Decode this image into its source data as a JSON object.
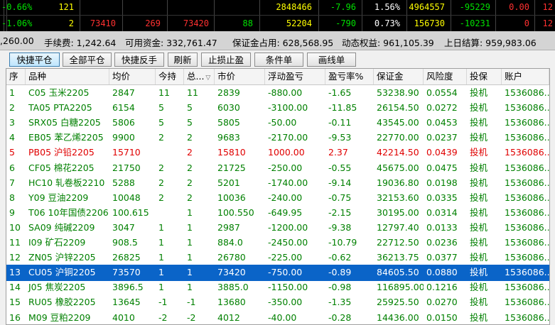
{
  "quotes": [
    [
      "-0.66%",
      "121",
      "",
      "",
      "",
      "",
      "2848466",
      "-7.96",
      "1.56%",
      "4964557",
      "-95229",
      "0.00",
      "12"
    ],
    [
      "-1.06%",
      "2",
      "73410",
      "269",
      "73420",
      "88",
      "52204",
      "-790",
      "0.73%",
      "156730",
      "-10231",
      "0",
      "12"
    ]
  ],
  "account": {
    "left": ",260.00",
    "fee_label": "手续费: 1,242.64",
    "available": "可用资金: 332,761.47",
    "margin": "保证金占用: 628,568.95",
    "equity": "动态权益: 961,105.39",
    "settle": "上日结算: 959,983.06"
  },
  "toolbar": [
    "快捷平仓",
    "全部平仓",
    "快捷反手",
    "刷新",
    "止损止盈",
    "条件单",
    "画线单"
  ],
  "columns": [
    "序",
    "品种",
    "均价",
    "今持",
    "总...",
    "市价",
    "浮动盈亏",
    "盈亏率%",
    "保证金",
    "风险度",
    "投保",
    "账户"
  ],
  "rows": [
    [
      "1",
      "C05 玉米2205",
      "2847",
      "11",
      "11",
      "2839",
      "-880.00",
      "-1.65",
      "53238.90",
      "0.0554",
      "投机",
      "1536086..."
    ],
    [
      "2",
      "TA05 PTA2205",
      "6154",
      "5",
      "5",
      "6030",
      "-3100.00",
      "-11.85",
      "26154.50",
      "0.0272",
      "投机",
      "1536086..."
    ],
    [
      "3",
      "SRX05 白糖2205",
      "5806",
      "5",
      "5",
      "5805",
      "-50.00",
      "-0.11",
      "43545.00",
      "0.0453",
      "投机",
      "1536086..."
    ],
    [
      "4",
      "EB05 苯乙烯2205",
      "9900",
      "2",
      "2",
      "9683",
      "-2170.00",
      "-9.53",
      "22770.00",
      "0.0237",
      "投机",
      "1536086..."
    ],
    [
      "5",
      "PB05 沪铅2205",
      "15710",
      "",
      "2",
      "15810",
      "1000.00",
      "2.37",
      "42214.50",
      "0.0439",
      "投机",
      "1536086..."
    ],
    [
      "6",
      "CF05 棉花2205",
      "21750",
      "2",
      "2",
      "21725",
      "-250.00",
      "-0.55",
      "45675.00",
      "0.0475",
      "投机",
      "1536086..."
    ],
    [
      "7",
      "HC10 轧卷板2210",
      "5288",
      "2",
      "2",
      "5201",
      "-1740.00",
      "-9.14",
      "19036.80",
      "0.0198",
      "投机",
      "1536086..."
    ],
    [
      "8",
      "Y09 豆油2209",
      "10048",
      "2",
      "2",
      "10036",
      "-240.00",
      "-0.75",
      "32153.60",
      "0.0335",
      "投机",
      "1536086..."
    ],
    [
      "9",
      "T06 10年国债2206",
      "100.615",
      "",
      "1",
      "100.550",
      "-649.95",
      "-2.15",
      "30195.00",
      "0.0314",
      "投机",
      "1536086..."
    ],
    [
      "10",
      "SA09 纯碱2209",
      "3047",
      "1",
      "1",
      "2987",
      "-1200.00",
      "-9.38",
      "12797.40",
      "0.0133",
      "投机",
      "1536086..."
    ],
    [
      "11",
      "I09 矿石2209",
      "908.5",
      "1",
      "1",
      "884.0",
      "-2450.00",
      "-10.79",
      "22712.50",
      "0.0236",
      "投机",
      "1536086..."
    ],
    [
      "12",
      "ZN05 沪锌2205",
      "26825",
      "1",
      "1",
      "26780",
      "-225.00",
      "-0.62",
      "36213.75",
      "0.0377",
      "投机",
      "1536086..."
    ],
    [
      "13",
      "CU05 沪铜2205",
      "73570",
      "1",
      "1",
      "73420",
      "-750.00",
      "-0.89",
      "84605.50",
      "0.0880",
      "投机",
      "1536086..."
    ],
    [
      "14",
      "J05 焦炭2205",
      "3896.5",
      "1",
      "1",
      "3885.0",
      "-1150.00",
      "-0.98",
      "116895.00",
      "0.1216",
      "投机",
      "1536086..."
    ],
    [
      "15",
      "RU05 橡胶2205",
      "13645",
      "-1",
      "-1",
      "13680",
      "-350.00",
      "-1.35",
      "25925.50",
      "0.0270",
      "投机",
      "1536086..."
    ],
    [
      "16",
      "M09 豆粕2209",
      "4010",
      "-2",
      "-2",
      "4012",
      "-40.00",
      "-0.28",
      "14436.00",
      "0.0150",
      "投机",
      "1536086..."
    ]
  ],
  "selected_row": 13,
  "colors": {
    "gain": "#e00000",
    "loss": "#008000",
    "selected": "#0a64c8"
  }
}
